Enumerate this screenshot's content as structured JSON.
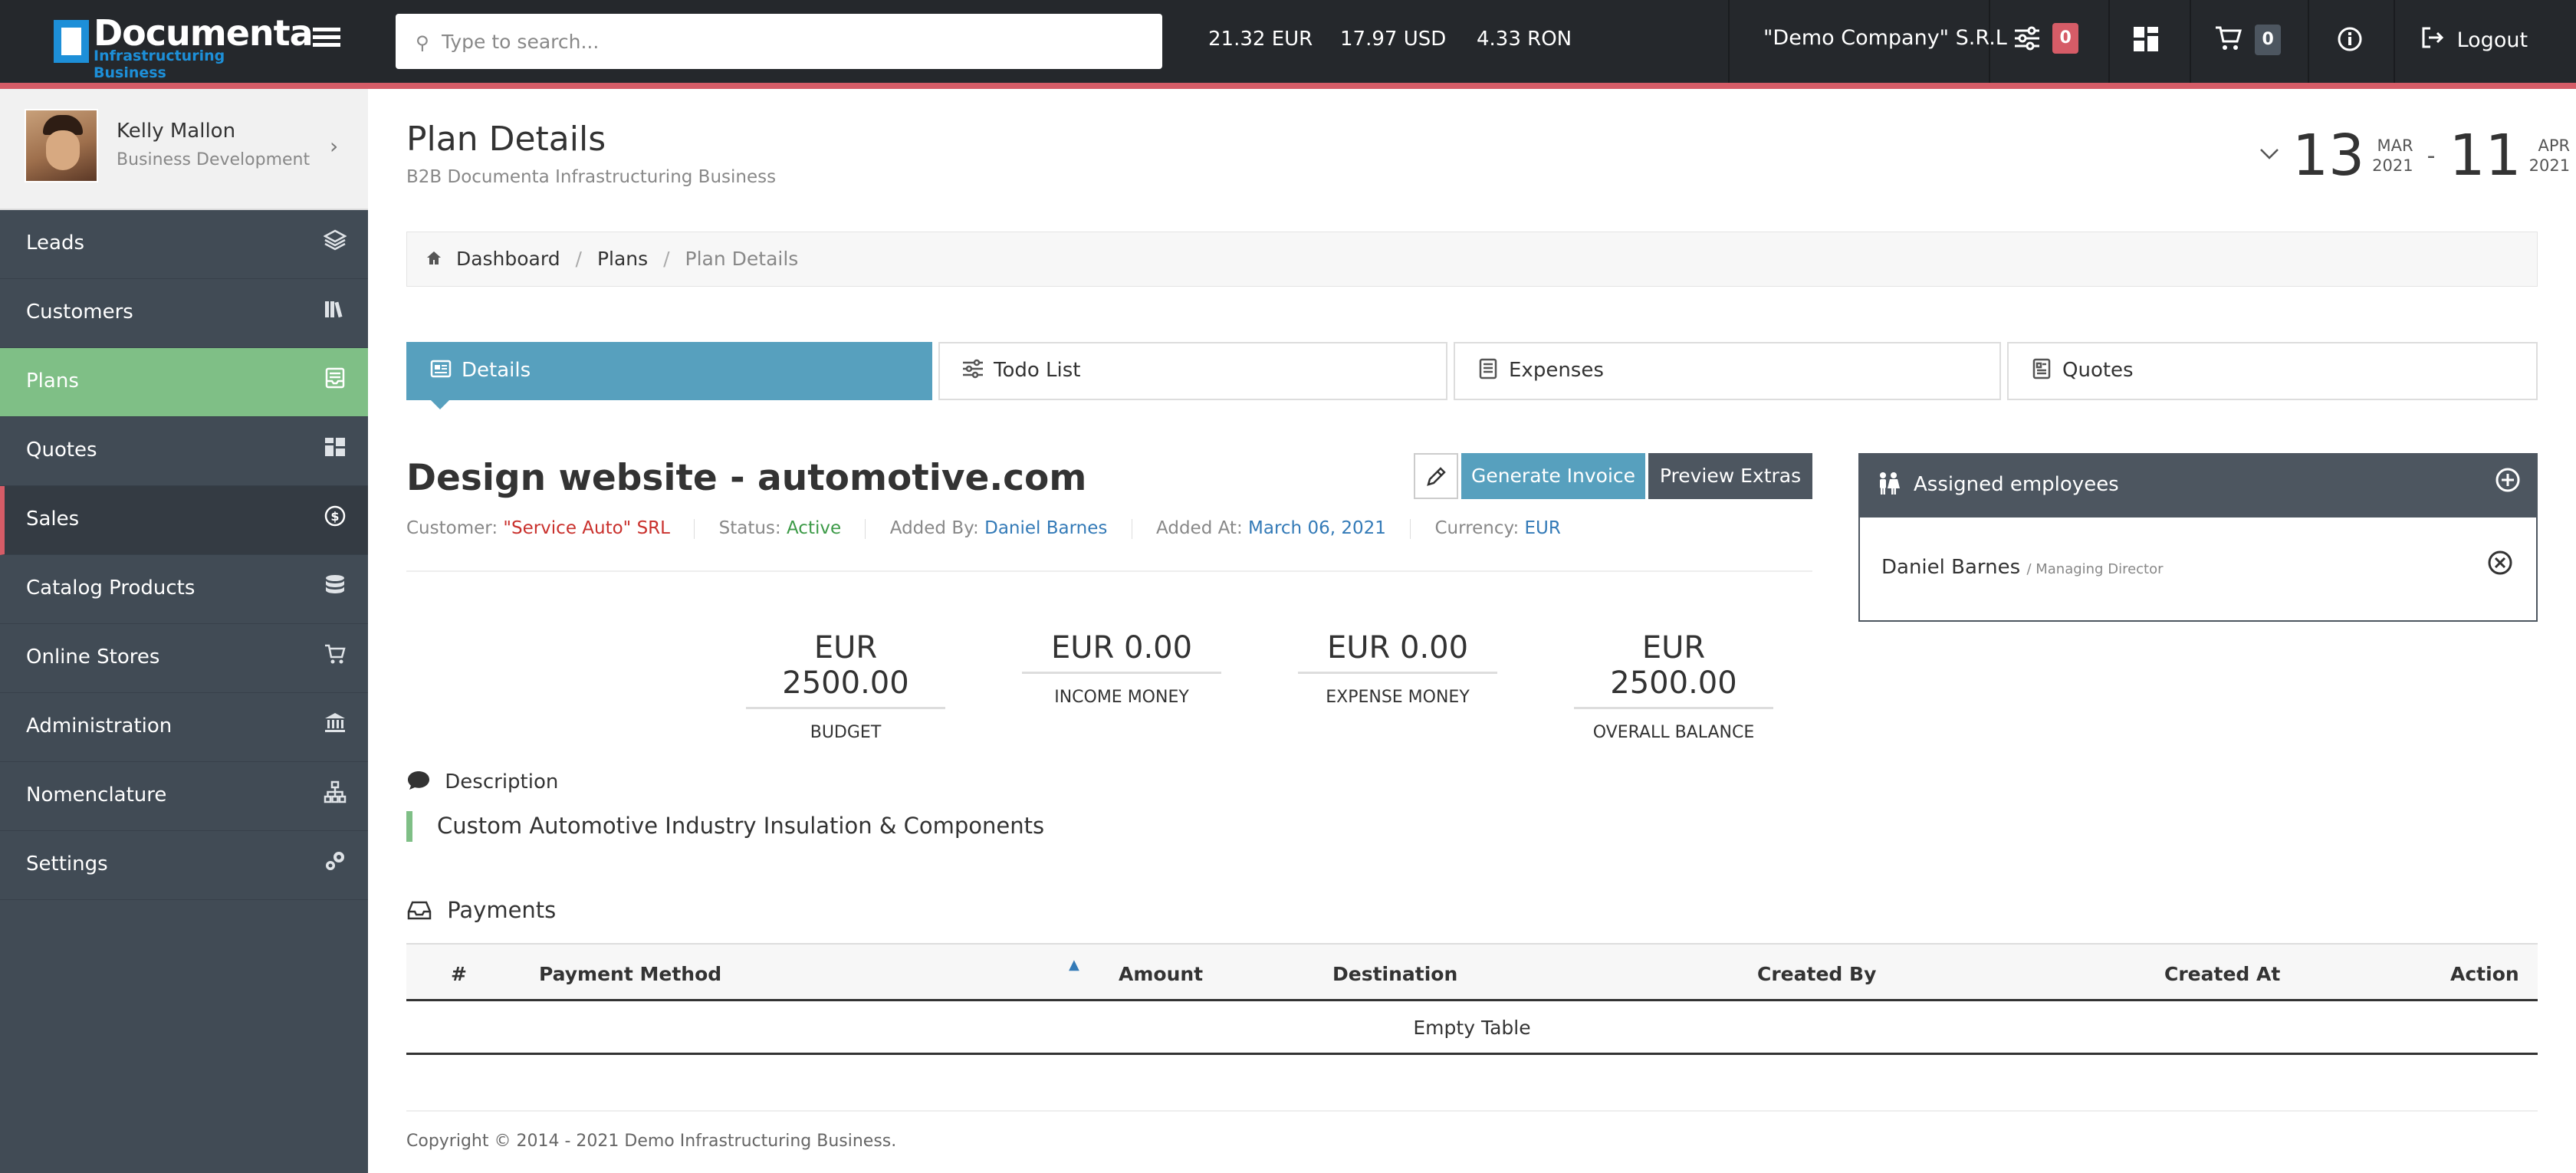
{
  "topbar": {
    "logo_title": "Documenta",
    "logo_sub": "Infrastructuring Business",
    "search_placeholder": "Type to search...",
    "currencies": [
      "21.32 EUR",
      "17.97 USD",
      "4.33 RON"
    ],
    "company": "\"Demo Company\" S.R.L",
    "filter_badge": "0",
    "cart_badge": "0",
    "logout_label": "Logout"
  },
  "profile": {
    "name": "Kelly Mallon",
    "role": "Business Development"
  },
  "sidebar": {
    "items": [
      {
        "label": "Leads",
        "icon": "layers-icon"
      },
      {
        "label": "Customers",
        "icon": "books-icon"
      },
      {
        "label": "Plans",
        "icon": "tray-icon"
      },
      {
        "label": "Quotes",
        "icon": "grid-icon"
      },
      {
        "label": "Sales",
        "icon": "dollar-circle-icon"
      },
      {
        "label": "Catalog Products",
        "icon": "database-icon"
      },
      {
        "label": "Online Stores",
        "icon": "cart-icon"
      },
      {
        "label": "Administration",
        "icon": "bank-icon"
      },
      {
        "label": "Nomenclature",
        "icon": "sitemap-icon"
      },
      {
        "label": "Settings",
        "icon": "gears-icon"
      }
    ]
  },
  "header": {
    "title": "Plan Details",
    "subtitle": "B2B Documenta Infrastructuring Business",
    "date_from": {
      "day": "13",
      "month": "MAR",
      "year": "2021"
    },
    "date_sep": "-",
    "date_to": {
      "day": "11",
      "month": "APR",
      "year": "2021"
    }
  },
  "breadcrumb": {
    "items": [
      "Dashboard",
      "Plans",
      "Plan Details"
    ]
  },
  "tabs": [
    "Details",
    "Todo List",
    "Expenses",
    "Quotes"
  ],
  "plan": {
    "title": "Design website - automotive.com",
    "customer_label": "Customer:",
    "customer": "\"Service Auto\" SRL",
    "status_label": "Status:",
    "status": "Active",
    "added_by_label": "Added By:",
    "added_by": "Daniel Barnes",
    "added_at_label": "Added At:",
    "added_at": "March 06, 2021",
    "currency_label": "Currency:",
    "currency": "EUR",
    "generate_label": "Generate Invoice",
    "preview_label": "Preview Extras"
  },
  "stats": [
    {
      "value": "EUR 2500.00",
      "label": "BUDGET"
    },
    {
      "value": "EUR 0.00",
      "label": "INCOME MONEY"
    },
    {
      "value": "EUR 0.00",
      "label": "EXPENSE MONEY"
    },
    {
      "value": "EUR 2500.00",
      "label": "OVERALL BALANCE"
    }
  ],
  "assigned": {
    "title": "Assigned employees",
    "employee_name": "Daniel Barnes",
    "employee_role": "/ Managing Director"
  },
  "description": {
    "heading": "Description",
    "text": "Custom Automotive Industry Insulation & Components"
  },
  "payments": {
    "heading": "Payments",
    "columns": [
      "#",
      "Payment Method",
      "Amount",
      "Destination",
      "Created By",
      "Created At",
      "Action"
    ],
    "empty": "Empty Table"
  },
  "footer": {
    "copyright": "Copyright © 2014 - 2021 Demo Infrastructuring Business."
  },
  "colors": {
    "accent": "#57a0be",
    "active_nav": "#7fbf86",
    "topbar_line": "#d65c67",
    "dark_panel": "#4d5660"
  }
}
